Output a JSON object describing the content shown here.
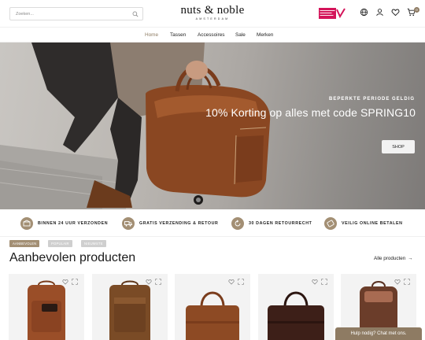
{
  "header": {
    "search_placeholder": "Zoeken...",
    "logo_main": "nuts & noble",
    "logo_sub": "AMSTERDAM",
    "trust_badge_text": "WEBSHOP KEURMERK",
    "cart_count": "0",
    "icons": [
      "search-icon",
      "globe-icon",
      "user-icon",
      "heart-icon",
      "cart-icon"
    ]
  },
  "nav": {
    "items": [
      "Home",
      "Tassen",
      "Accessoires",
      "Sale",
      "Merken"
    ],
    "active": "Home"
  },
  "hero": {
    "eyebrow": "BEPERKTE PERIODE GELDIG",
    "title": "10% Korting op alles met code SPRING10",
    "button": "SHOP"
  },
  "usps": [
    {
      "text": "BINNEN 24 UUR VERZONDEN",
      "icon": "delivery-icon"
    },
    {
      "text": "GRATIS VERZENDING & RETOUR",
      "icon": "truck-icon"
    },
    {
      "text": "30 DAGEN RETOURRECHT",
      "icon": "return-icon"
    },
    {
      "text": "VEILIG ONLINE BETALEN",
      "icon": "card-icon"
    }
  ],
  "tabs": [
    "AANBEVOLEN",
    "POPULAIR",
    "NIEUWSTE"
  ],
  "section": {
    "title": "Aanbevolen producten",
    "all_link": "Alle producten"
  },
  "products": [
    {
      "type": "backpack",
      "color": "#9a4e28"
    },
    {
      "type": "backpack",
      "color": "#7a4b26"
    },
    {
      "type": "briefcase",
      "color": "#8d4a24"
    },
    {
      "type": "briefcase",
      "color": "#3d1f18"
    },
    {
      "type": "backpack",
      "color": "#6b3d2a"
    }
  ],
  "chat": {
    "label": "Hulp nodig? Chat met ons."
  },
  "colors": {
    "accent": "#a38f74",
    "chat": "#8e7b63"
  }
}
